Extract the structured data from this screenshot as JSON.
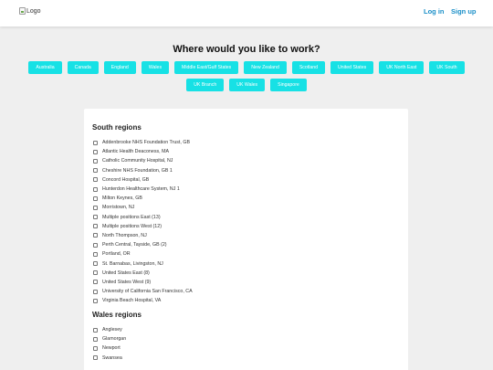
{
  "header": {
    "logo_alt": "Logo",
    "login_label": "Log in",
    "signup_label": "Sign up",
    "link_color": "#1a8fc8"
  },
  "heading": "Where would you like to work?",
  "chip_color": "#17e1e5",
  "chips_row1": [
    "Australia",
    "Canada",
    "England",
    "Wales",
    "Middle East/Gulf States",
    "New Zealand",
    "Scotland",
    "United States",
    "UK North East",
    "UK South"
  ],
  "chips_row2": [
    "UK Branch",
    "UK Wales",
    "Singapore"
  ],
  "sections": [
    {
      "title": "South regions",
      "items": [
        "Addenbrooke NHS Foundation Trust, GB",
        "Atlantic Health Deaconess, MA",
        "Catholic Community Hospital, NJ",
        "Cheshire NHS Foundation, GB 1",
        "Concord Hospital, GB",
        "Hunterdon Healthcare System, NJ 1",
        "Milton Keynes, GB",
        "Morristown, NJ",
        "Multiple positions East (13)",
        "Multiple positions West (12)",
        "North Thompson, NJ",
        "Perth Central, Tayside, GB (2)",
        "Portland, OR",
        "St. Barnabas, Livingston, NJ",
        "United States East (8)",
        "United States West (9)",
        "University of California San Francisco, CA",
        "Virginia Beach Hospital, VA"
      ]
    },
    {
      "title": "Wales regions",
      "items": [
        "Anglesey",
        "Glamorgan",
        "Newport",
        "Swansea"
      ]
    }
  ]
}
